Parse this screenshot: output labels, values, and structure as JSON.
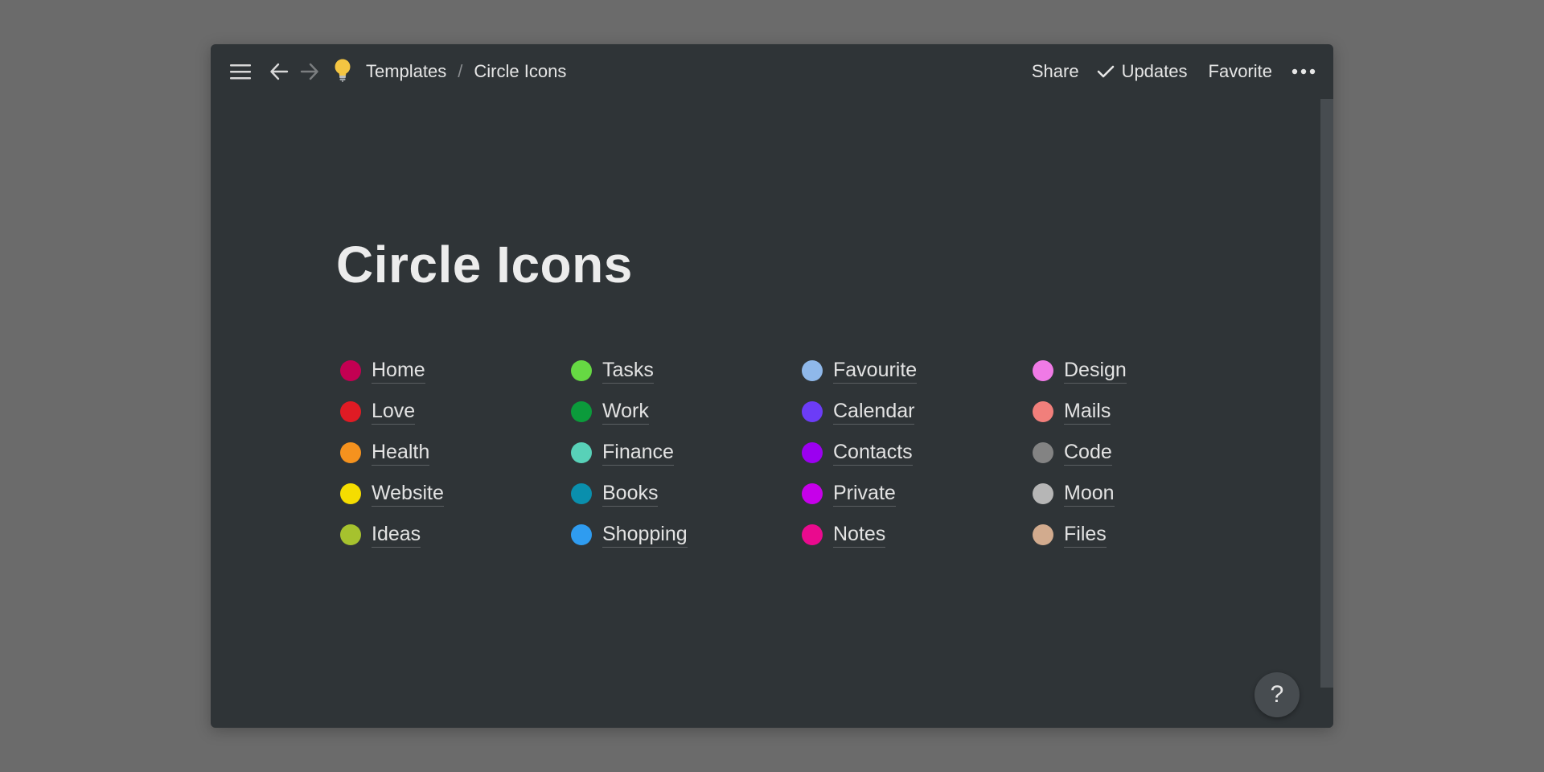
{
  "header": {
    "breadcrumb": [
      "Templates",
      "Circle Icons"
    ],
    "breadcrumb_separator": "/",
    "actions": {
      "share": "Share",
      "updates": "Updates",
      "favorite": "Favorite"
    },
    "icons": {
      "menu": "hamburger-menu-icon",
      "back": "arrow-left-icon",
      "forward": "arrow-right-icon",
      "page": "lightbulb-icon",
      "updates": "checkmark-icon",
      "more": "more-horizontal-icon"
    }
  },
  "page": {
    "title": "Circle Icons"
  },
  "columns": [
    [
      {
        "label": "Home",
        "color": "#c30052"
      },
      {
        "label": "Love",
        "color": "#e01b24"
      },
      {
        "label": "Health",
        "color": "#f5921e"
      },
      {
        "label": "Website",
        "color": "#f5dd00"
      },
      {
        "label": "Ideas",
        "color": "#a6c22e"
      }
    ],
    [
      {
        "label": "Tasks",
        "color": "#66d943"
      },
      {
        "label": "Work",
        "color": "#0b9b3b"
      },
      {
        "label": "Finance",
        "color": "#58d1b8"
      },
      {
        "label": "Books",
        "color": "#0a8fad"
      },
      {
        "label": "Shopping",
        "color": "#2f9cf0"
      }
    ],
    [
      {
        "label": "Favourite",
        "color": "#8fb8ea"
      },
      {
        "label": "Calendar",
        "color": "#6c3cf7"
      },
      {
        "label": "Contacts",
        "color": "#9b00f0"
      },
      {
        "label": "Private",
        "color": "#c600ea"
      },
      {
        "label": "Notes",
        "color": "#ea0a8e"
      }
    ],
    [
      {
        "label": "Design",
        "color": "#f07ae6"
      },
      {
        "label": "Mails",
        "color": "#f17f7b"
      },
      {
        "label": "Code",
        "color": "#838383"
      },
      {
        "label": "Moon",
        "color": "#b6b6b6"
      },
      {
        "label": "Files",
        "color": "#d2ab8e"
      }
    ]
  ],
  "help": {
    "label": "?"
  }
}
